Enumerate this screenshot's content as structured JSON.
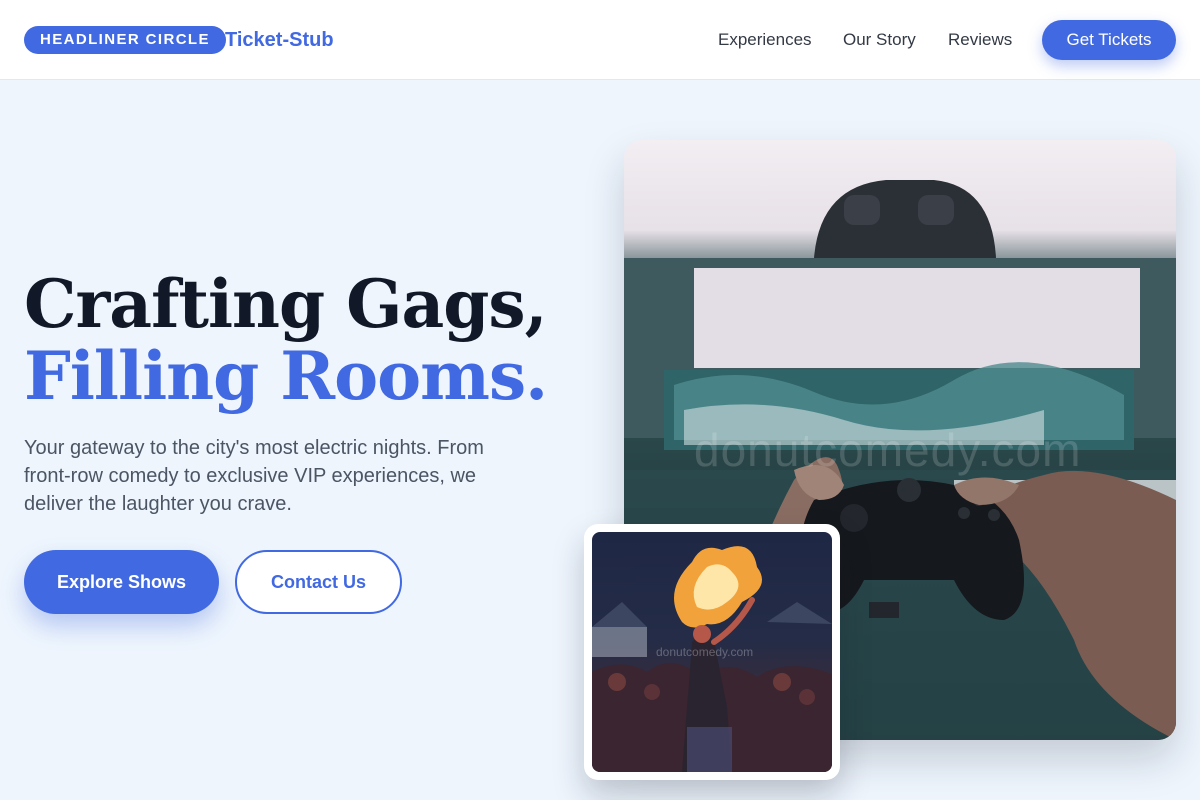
{
  "header": {
    "badge": "HEADLINER CIRCLE",
    "brand": "Ticket-Stub",
    "nav": [
      "Experiences",
      "Our Story",
      "Reviews"
    ],
    "cta": "Get Tickets"
  },
  "hero": {
    "headline_line1": "Crafting Gags,",
    "headline_line2": "Filling Rooms.",
    "lead": "Your gateway to the city's most electric nights. From front-row comedy to exclusive VIP experiences, we deliver the laughter you crave.",
    "primary_button": "Explore Shows",
    "secondary_button": "Contact Us"
  },
  "images": {
    "main_watermark": "donutcomedy.com",
    "secondary_watermark": "donutcomedy.com"
  },
  "colors": {
    "accent": "#4169e1",
    "background": "#eef5fd",
    "heading": "#111827",
    "body_text": "#4b5563"
  }
}
